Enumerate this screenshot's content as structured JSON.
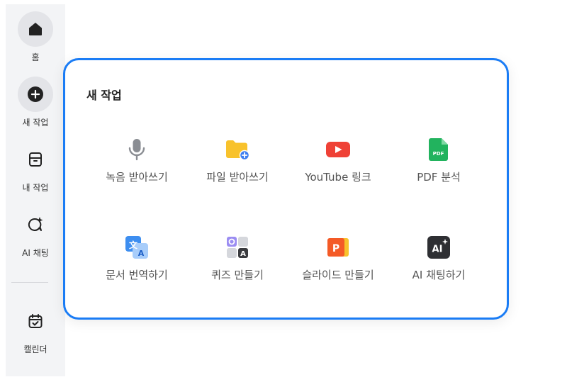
{
  "sidebar": {
    "items": [
      {
        "label": "홈",
        "icon": "home-icon"
      },
      {
        "label": "새 작업",
        "icon": "plus-circle-icon"
      },
      {
        "label": "내 작업",
        "icon": "archive-box-icon"
      },
      {
        "label": "AI 채팅",
        "icon": "ai-chat-sparkle-icon"
      },
      {
        "label": "캘린더",
        "icon": "calendar-check-icon"
      }
    ]
  },
  "panel": {
    "title": "새 작업",
    "tiles": [
      {
        "label": "녹음 받아쓰기",
        "icon": "microphone-icon"
      },
      {
        "label": "파일 받아쓰기",
        "icon": "folder-add-icon"
      },
      {
        "label": "YouTube 링크",
        "icon": "youtube-icon"
      },
      {
        "label": "PDF 분석",
        "icon": "pdf-file-icon"
      },
      {
        "label": "문서 번역하기",
        "icon": "translate-icon"
      },
      {
        "label": "퀴즈 만들기",
        "icon": "quiz-icon"
      },
      {
        "label": "슬라이드 만들기",
        "icon": "slides-icon"
      },
      {
        "label": "AI 채팅하기",
        "icon": "ai-chat-icon"
      }
    ]
  },
  "colors": {
    "accent_border": "#1a7cf5",
    "sidebar_bg": "#f3f4f6",
    "youtube_red": "#ef4136",
    "pdf_green": "#22b35e",
    "folder_yellow": "#f8c22c",
    "translate_blue": "#3d8ef0",
    "slides_orange": "#f45a26"
  }
}
